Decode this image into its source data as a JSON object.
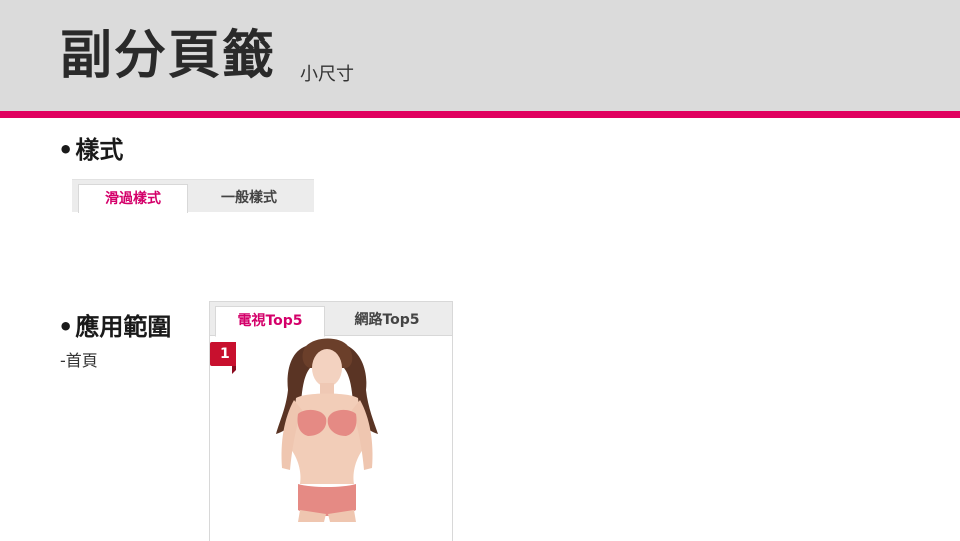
{
  "header": {
    "title": "副分頁籤",
    "subtitle": "小尺寸"
  },
  "colors": {
    "accent": "#e0005f",
    "header_bg": "#dbdbdb",
    "active_tab_text": "#d4006a",
    "rank_badge": "#c8102e"
  },
  "sections": {
    "style": {
      "bullet": "•",
      "label": "樣式",
      "tabs": [
        {
          "label": "滑過樣式",
          "active": true
        },
        {
          "label": "一般樣式",
          "active": false
        }
      ]
    },
    "usage": {
      "bullet": "•",
      "label": "應用範圍",
      "sub": "-首頁",
      "tabs": [
        {
          "label": "電視Top5",
          "active": true
        },
        {
          "label": "網路Top5",
          "active": false
        }
      ],
      "rank": "1",
      "product_image": "lingerie-model-photo"
    }
  }
}
